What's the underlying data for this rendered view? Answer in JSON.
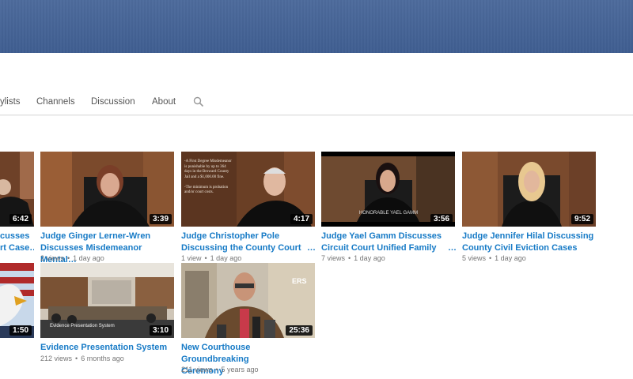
{
  "channel_tabs": {
    "playlists": "ylists",
    "channels": "Channels",
    "discussion": "Discussion",
    "about": "About"
  },
  "videos": [
    {
      "title_l1": "cusses",
      "title_l2": "rt Case…",
      "duration": "6:42"
    },
    {
      "title_l1": "Judge Ginger Lerner-Wren",
      "title_l2": "Discusses Misdemeanor Mental…",
      "views": "2 views",
      "age": "1 day ago",
      "duration": "3:39"
    },
    {
      "title_l1": "Judge Christopher Pole",
      "title_l2": "Discussing the County Court",
      "ellipsis": "…",
      "views": "1 view",
      "age": "1 day ago",
      "duration": "4:17",
      "overlay_text": [
        "-A First Degree Misdemeanor",
        "is punishable by up to 364",
        "days in the Broward County",
        "Jail and a $1,000.00 fine.",
        "",
        "-The minimum is probation",
        "and/or court costs."
      ]
    },
    {
      "title_l1": "Judge Yael Gamm Discusses",
      "title_l2": "Circuit Court Unified Family",
      "ellipsis": "…",
      "views": "7 views",
      "age": "1 day ago",
      "duration": "3:56",
      "lower_third": "HONORABLE YAEL GAMM"
    },
    {
      "title_l1": "Judge Jennifer Hilal Discussing",
      "title_l2": "County Civil Eviction Cases",
      "views": "5 views",
      "age": "1 day ago",
      "duration": "9:52"
    },
    {
      "duration": "1:50"
    },
    {
      "title_l1": "Evidence Presentation System",
      "views": "212 views",
      "age": "6 months ago",
      "duration": "3:10",
      "thumb_caption": "Evidence Presentation System"
    },
    {
      "title_l1": "New Courthouse Groundbreaking",
      "title_l2": "Ceremony",
      "views": "211 views",
      "age": "5 years ago",
      "duration": "25:36",
      "sign_text": "ERS"
    }
  ],
  "colors": {
    "banner": "#4a679a",
    "link": "#167ac6",
    "meta": "#767676"
  }
}
